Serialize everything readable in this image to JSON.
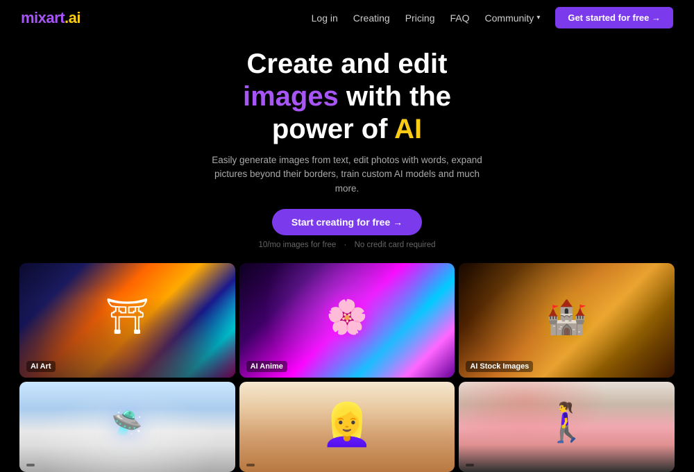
{
  "nav": {
    "logo": {
      "mix": "mix",
      "art": "art",
      "dot": ".",
      "ai": "ai"
    },
    "links": [
      {
        "label": "Log in",
        "id": "login"
      },
      {
        "label": "Creating",
        "id": "creating"
      },
      {
        "label": "Pricing",
        "id": "pricing"
      },
      {
        "label": "FAQ",
        "id": "faq"
      },
      {
        "label": "Community",
        "id": "community"
      }
    ],
    "community_chevron": "▾",
    "cta_button": "Get started for free →"
  },
  "hero": {
    "headline_1": "Create and edit",
    "headline_2_purple": "images",
    "headline_2_rest": " with the",
    "headline_3_start": "power of ",
    "headline_3_yellow": "AI",
    "subtitle": "Easily generate images from text, edit photos with words, expand pictures beyond their borders, train custom AI models and much more.",
    "cta_button": "Start creating for free →",
    "note_left": "10/mo images for free",
    "note_dot": "·",
    "note_right": "No credit card required"
  },
  "gallery": {
    "items": [
      {
        "id": "ai-art",
        "label": "AI Art",
        "row": 1,
        "col": 1
      },
      {
        "id": "ai-anime",
        "label": "AI Anime",
        "row": 1,
        "col": 2
      },
      {
        "id": "ai-stock",
        "label": "AI Stock Images",
        "row": 1,
        "col": 3
      },
      {
        "id": "ai-scifi",
        "label": "",
        "row": 2,
        "col": 1
      },
      {
        "id": "ai-portrait",
        "label": "",
        "row": 2,
        "col": 2
      },
      {
        "id": "ai-street",
        "label": "",
        "row": 2,
        "col": 3
      }
    ]
  }
}
